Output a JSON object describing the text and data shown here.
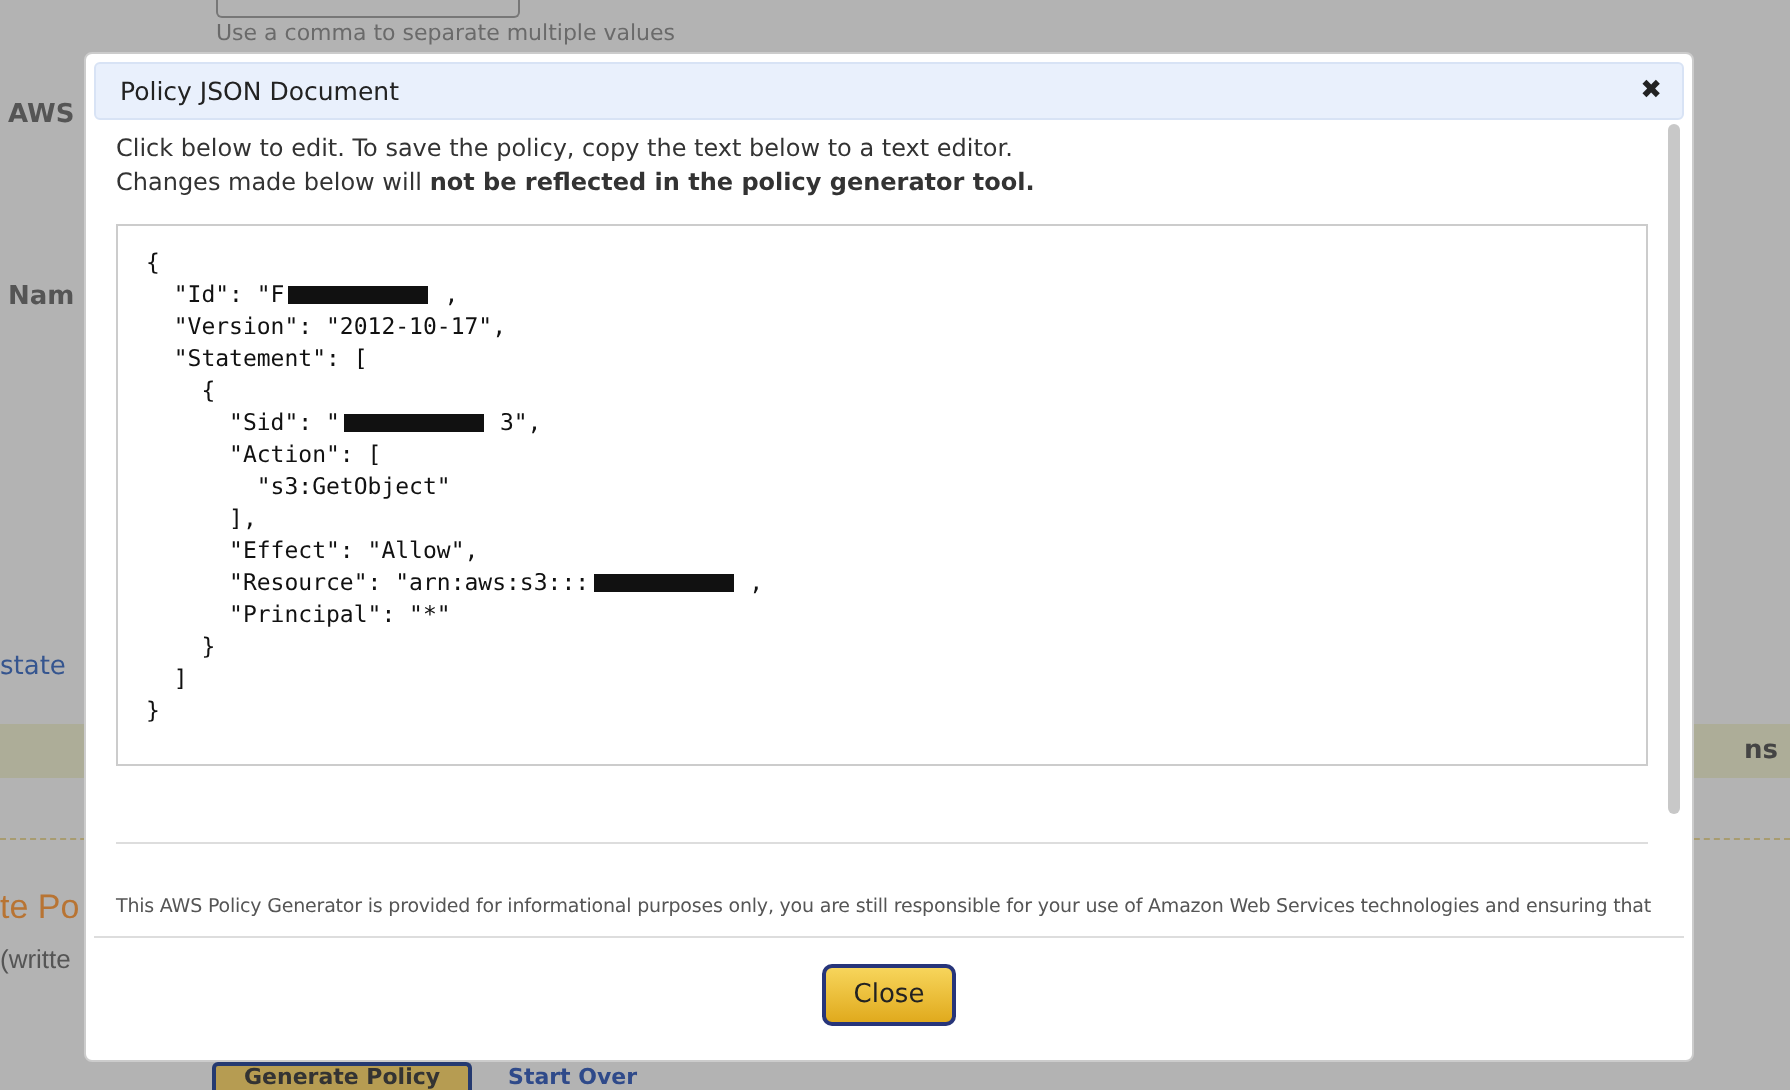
{
  "background": {
    "hint": "Use a comma to separate multiple values",
    "labels": [
      "AWS",
      "Nam"
    ],
    "statement_text": "state",
    "band_text": "ns",
    "heading": "te Po",
    "subtext": "(writte",
    "generate_button": "Generate Policy",
    "start_over_link": "Start Over"
  },
  "dialog": {
    "title": "Policy JSON Document",
    "close_icon": "✖",
    "intro": "Click below to edit. To save the policy, copy the text below to a text editor.",
    "warning": "Changes made below will **not be reflected in the policy generator tool.**",
    "code_lines": [
      {
        "text": "{",
        "redacted": false
      },
      {
        "text": "  \"Id\": \"F",
        "redacted": true,
        "tail": ","
      },
      {
        "text": "  \"Version\": \"2012-10-17\",",
        "redacted": false
      },
      {
        "text": "  \"Statement\": [",
        "redacted": false
      },
      {
        "text": "    {",
        "redacted": false
      },
      {
        "text": "      \"Sid\": \"",
        "redacted": true,
        "tail": "3\","
      },
      {
        "text": "      \"Action\": [",
        "redacted": false
      },
      {
        "text": "        \"s3:GetObject\"",
        "redacted": false
      },
      {
        "text": "      ],",
        "redacted": false
      },
      {
        "text": "      \"Effect\": \"Allow\",",
        "redacted": false
      },
      {
        "text": "      \"Resource\": \"arn:aws:s3:::",
        "redacted": true,
        "tail": ","
      },
      {
        "text": "      \"Principal\": \"*\"",
        "redacted": false
      },
      {
        "text": "    }",
        "redacted": false
      },
      {
        "text": "  ]",
        "redacted": false
      },
      {
        "text": "}",
        "redacted": false
      }
    ],
    "disclaimer": "This AWS Policy Generator is provided for informational purposes only, you are still responsible for your use of Amazon Web Services technologies and ensuring that",
    "close_button": "Close"
  }
}
